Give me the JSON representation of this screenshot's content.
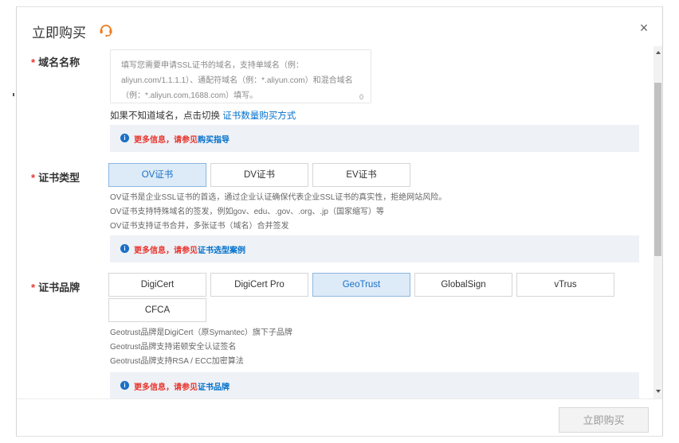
{
  "dialog": {
    "title": "立即购买",
    "close_icon": "×",
    "support_icon": "headset-icon",
    "buy_button": "立即购买"
  },
  "domain": {
    "label": "域名名称",
    "placeholder": "填写您需要申请SSL证书的域名，支持单域名（例：aliyun.com/1.1.1.1）、通配符域名（例：*.aliyun.com）和混合域名（例：*.aliyun.com,1688.com）填写。",
    "counter": "0",
    "switch_text": "如果不知道域名，点击切换",
    "switch_link": "证书数量购买方式",
    "info_text": "更多信息，请参见",
    "info_link": "购买指导"
  },
  "cert_type": {
    "label": "证书类型",
    "options": [
      "OV证书",
      "DV证书",
      "EV证书"
    ],
    "selected": "OV证书",
    "desc": [
      "OV证书是企业SSL证书的首选，通过企业认证确保代表企业SSL证书的真实性，拒绝网站风险。",
      "OV证书支持特殊域名的签发，例如gov、edu、.gov、.org、.jp（国家缩写）等",
      "OV证书支持证书合并，多张证书（域名）合并签发"
    ],
    "info_text": "更多信息，请参见",
    "info_link": "证书选型案例"
  },
  "cert_brand": {
    "label": "证书品牌",
    "options": [
      "DigiCert",
      "DigiCert Pro",
      "GeoTrust",
      "GlobalSign",
      "vTrus",
      "CFCA"
    ],
    "selected": "GeoTrust",
    "desc": [
      "Geotrust品牌是DigiCert（原Symantec）旗下子品牌",
      "Geotrust品牌支持诺顿安全认证签名",
      "Geotrust品牌支持RSA / ECC加密算法"
    ],
    "info_text": "更多信息，请参见",
    "info_link": "证书品牌"
  },
  "colors": {
    "accent": "#0070cc",
    "required": "#e8352e",
    "selected_bg": "#ddebf8",
    "info_bg": "#eef1f5"
  }
}
